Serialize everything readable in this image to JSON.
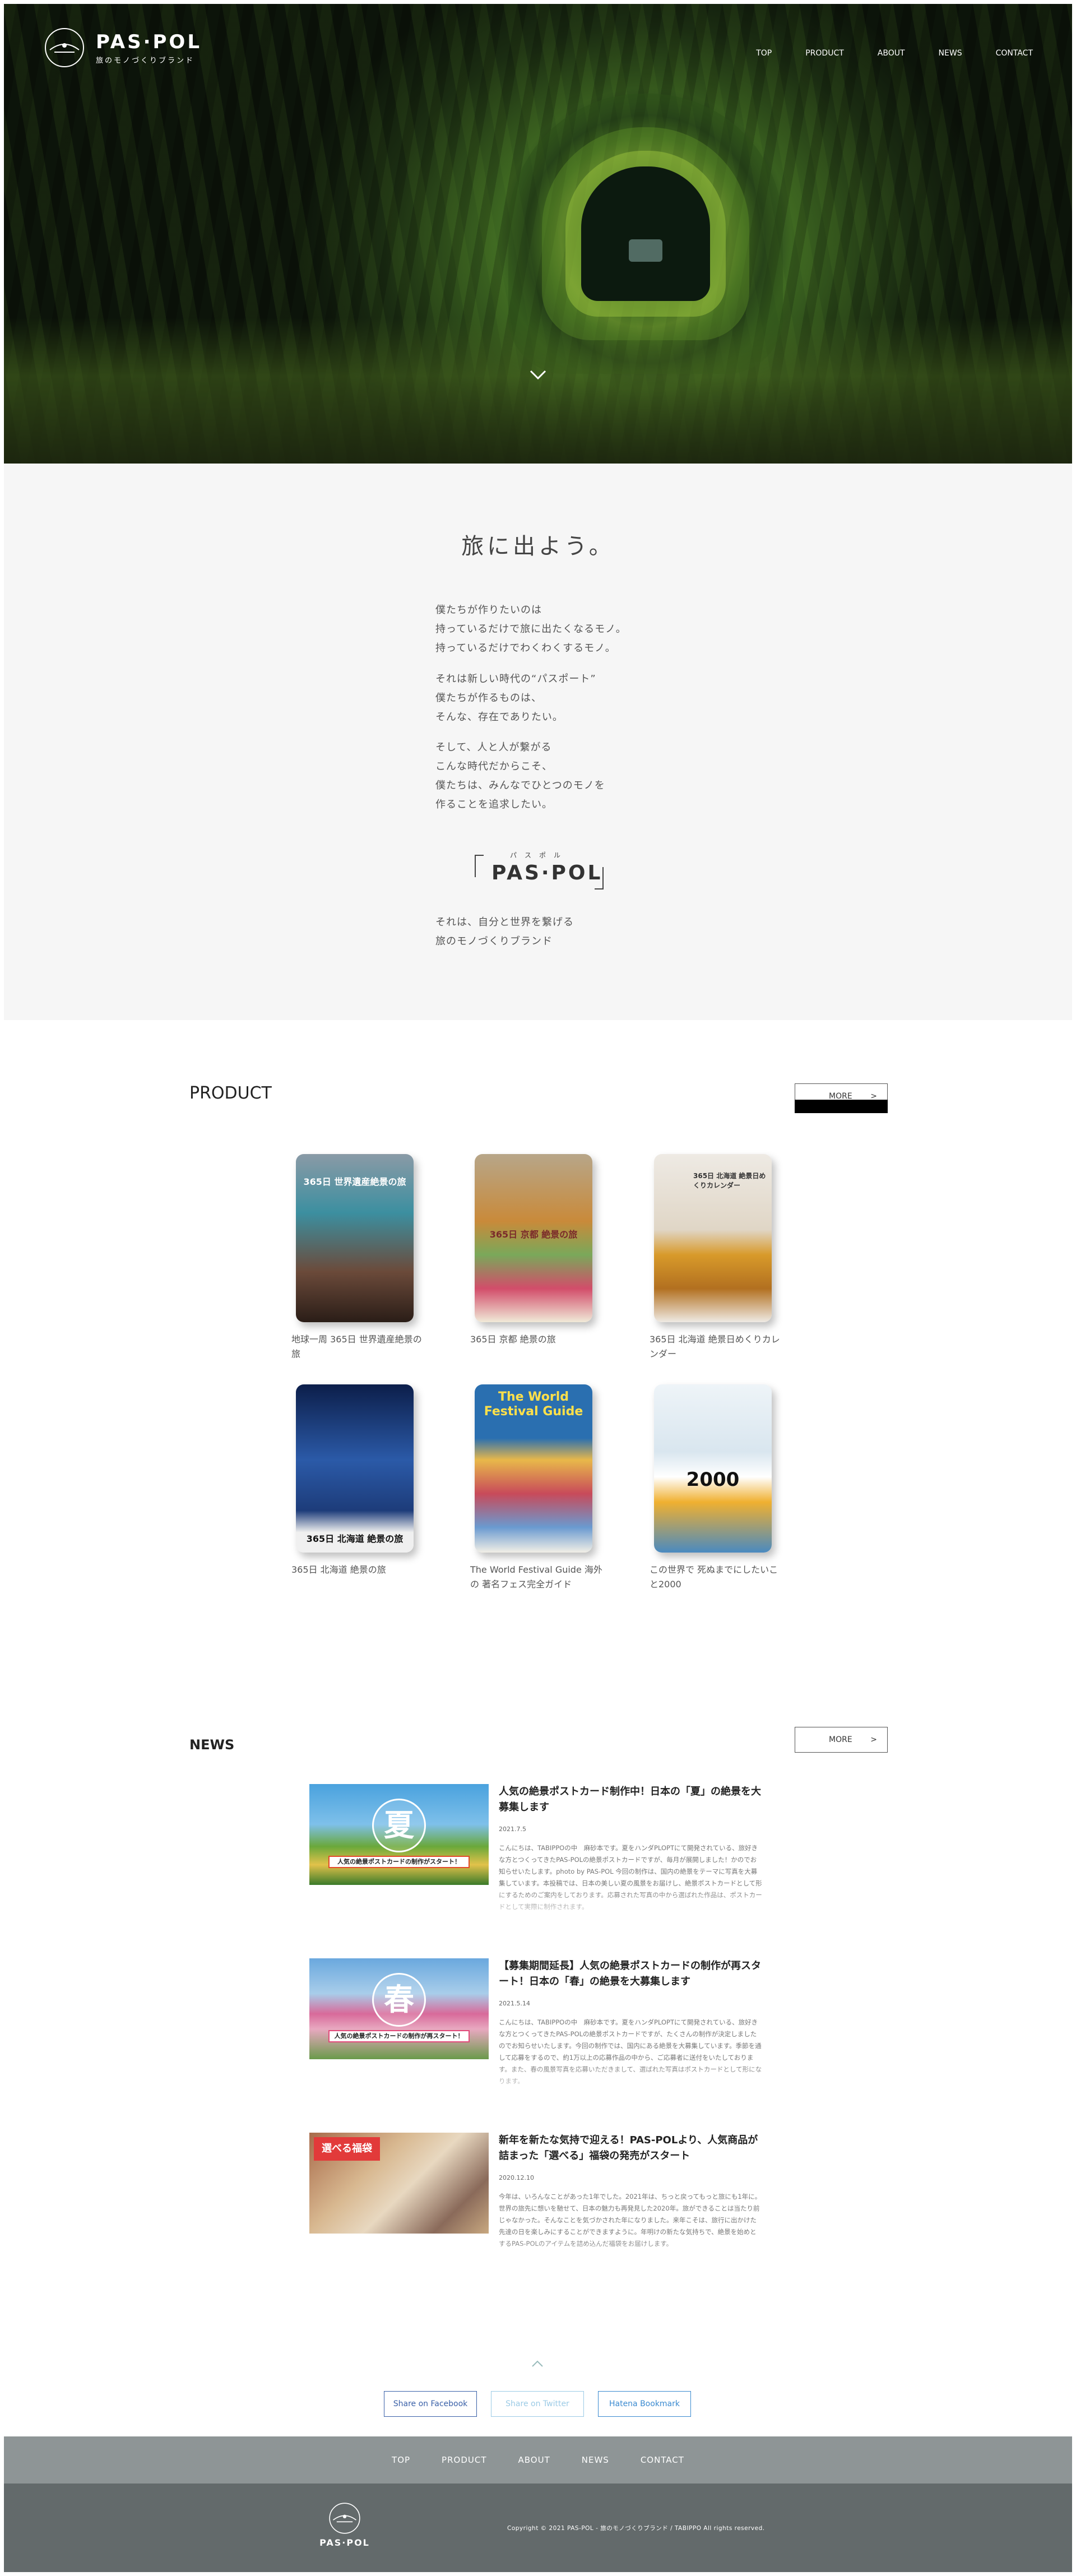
{
  "header": {
    "logo_name": "PAS·POL",
    "logo_tagline": "旅のモノづくりブランド",
    "nav": [
      "TOP",
      "PRODUCT",
      "ABOUT",
      "NEWS",
      "CONTACT"
    ]
  },
  "about": {
    "heading": "旅に出よう。",
    "paragraphs": [
      [
        "僕たちが作りたいのは",
        "持っているだけで旅に出たくなるモノ。",
        "持っているだけでわくわくするモノ。"
      ],
      [
        "それは新しい時代の“パスポート”",
        "僕たちが作るものは、",
        "そんな、存在でありたい。"
      ],
      [
        "そして、人と人が繋がる",
        "こんな時代だからこそ、",
        "僕たちは、みんなでひとつのモノを",
        "作ることを追求したい。"
      ]
    ],
    "brand_ruby": "パスポル",
    "brand_name": "PAS·POL",
    "closing": [
      "それは、自分と世界を繋げる",
      "旅のモノづくりブランド"
    ]
  },
  "product": {
    "title": "PRODUCT",
    "more_label": "MORE",
    "more_arrow": ">",
    "items": [
      {
        "name": "地球一周 365日 世界遺産絶景の旅",
        "cover": "365日 世界遺産絶景の旅",
        "color": "#6b4a3a"
      },
      {
        "name": "365日 京都 絶景の旅",
        "cover": "365日 京都 絶景の旅",
        "color": "#c98a3a"
      },
      {
        "name": "365日 北海道 絶景日めくりカレンダー",
        "cover": "365日 北海道 絶景日めくりカレンダー",
        "color": "#d8c9a8"
      },
      {
        "name": "365日 北海道 絶景の旅",
        "cover": "365日 北海道 絶景の旅",
        "color": "#1d3c7a"
      },
      {
        "name": "The World Festival Guide 海外の 著名フェス完全ガイド",
        "cover": "The World Festival Guide",
        "color": "#2a6fb0"
      },
      {
        "name": "この世界で 死ぬまでにしたいこと2000",
        "cover": "2000",
        "color": "#d9e6ef"
      }
    ]
  },
  "news": {
    "title": "NEWS",
    "more_label": "MORE",
    "more_arrow": ">",
    "items": [
      {
        "title": "人気の絶景ポストカード制作中！日本の「夏」の絶景を大募集します",
        "date": "2021.7.5",
        "badge": "夏",
        "banner": "人気の絶景ポストカードの制作がスタート！",
        "text": "こんにちは、TABIPPOの中　麻砂本です。夏をハンダPLOPTにて開発されている、旅好きな方とつくってきたPAS-POLの絶景ポストカードですが、毎月が展開しました！かのでお知らせいたします。photo by PAS-POL 今回の制作は、国内の絶景をテーマに写真を大募集しています。本投稿では、日本の美しい夏の風景をお届けし、絶景ポストカードとして形にするためのご案内をしております。応募された写真の中から選ばれた作品は、ポストカードとして実際に制作されます。"
      },
      {
        "title": "【募集期間延長】人気の絶景ポストカードの制作が再スタート！日本の「春」の絶景を大募集します",
        "date": "2021.5.14",
        "badge": "春",
        "banner": "人気の絶景ポストカードの制作が再スタート！",
        "text": "こんにちは、TABIPPOの中　麻砂本です。夏をハンダPLOPTにて開発されている、旅好きな方とつくってきたPAS-POLの絶景ポストカードですが、たくさんの制作が決定しましたのでお知らせいたします。今回の制作では、国内にある絶景を大募集しています。季節を通して応募をするので、約1万以上の応募作品の中から、ご応募者に送付をいたしております。また、春の風景写真を応募いただきまして、選ばれた写真はポストカードとして形になります。"
      },
      {
        "title": "新年を新たな気持で迎える！PAS-POLより、人気商品が詰まった「選べる」福袋の発売がスタート",
        "date": "2020.12.10",
        "badge": "選べる福袋",
        "banner": "",
        "text": "今年は、いろんなことがあった1年でした。2021年は、ちっと戻ってもっと旅にも1年に。世界の旅先に想いを馳せて、日本の魅力も再発見した2020年。旅ができることは当たり前じゃなかった。そんなことを気づかされた年になりました。来年こそは、旅行に出かけた先達の日を楽しみにすることができますように。年明けの新たな気持ちで、絶景を始めとするPAS-POLのアイテムを詰め込んだ福袋をお届けします。"
      }
    ]
  },
  "share": [
    "Share on Facebook",
    "Share on Twitter",
    "Hatena Bookmark"
  ],
  "footer": {
    "nav": [
      "TOP",
      "PRODUCT",
      "ABOUT",
      "NEWS",
      "CONTACT"
    ],
    "logo": "PAS·POL",
    "copyright": "Copyright © 2021 PAS-POL - 旅のモノづくりブランド / TABIPPO All rights reserved."
  }
}
